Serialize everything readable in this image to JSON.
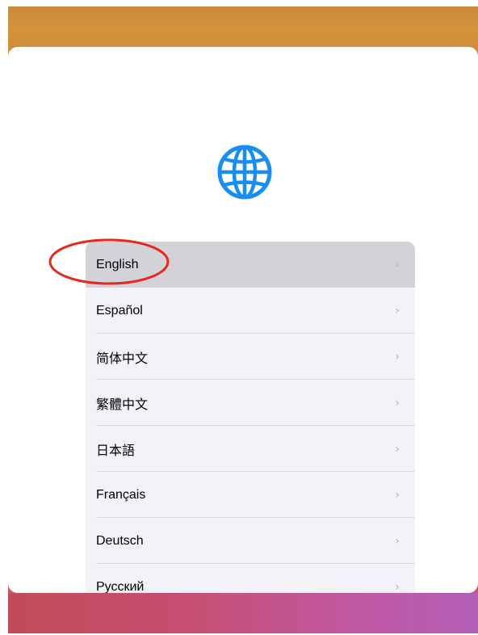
{
  "setup": {
    "globe_icon": "globe-icon",
    "accent_color": "#1a8df0",
    "highlight_color": "#e5291c",
    "chevron_glyph": "›",
    "languages": [
      {
        "label": "English",
        "selected": true
      },
      {
        "label": "Español"
      },
      {
        "label": "简体中文"
      },
      {
        "label": "繁體中文"
      },
      {
        "label": "日本語"
      },
      {
        "label": "Français"
      },
      {
        "label": "Deutsch"
      },
      {
        "label": "Русский"
      }
    ]
  }
}
